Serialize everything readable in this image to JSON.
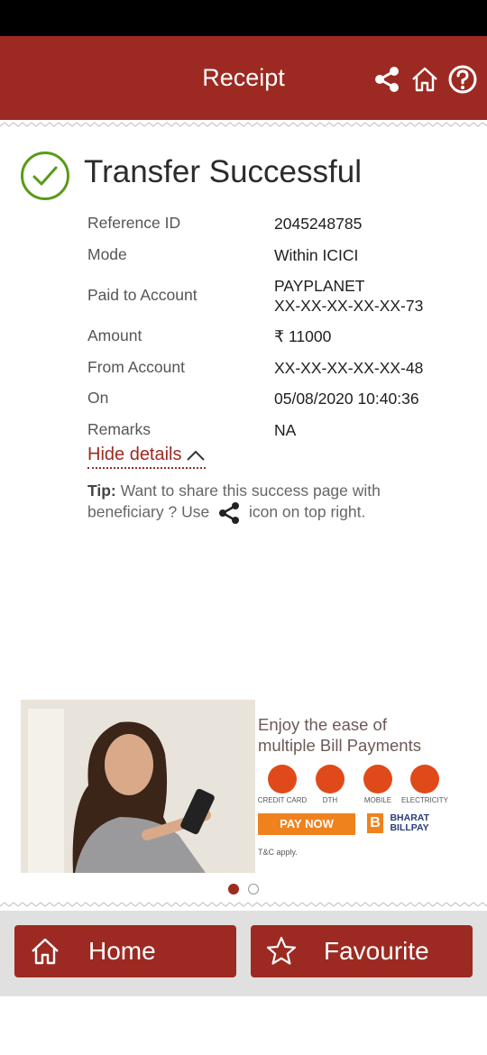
{
  "header": {
    "title": "Receipt",
    "share_icon": "share-icon",
    "home_icon": "home-icon",
    "help_icon": "help-icon"
  },
  "status": {
    "title": "Transfer Successful",
    "icon": "check-circle-icon",
    "color": "#5a9a1a"
  },
  "details": [
    {
      "label": "Reference ID",
      "value": "2045248785"
    },
    {
      "label": "Mode",
      "value": "Within ICICI"
    },
    {
      "label": "Paid to Account",
      "value": "PAYPLANET",
      "value2": "XX-XX-XX-XX-XX-73"
    },
    {
      "label": "Amount",
      "value": "₹ 11000"
    },
    {
      "label": "From Account",
      "value": "XX-XX-XX-XX-XX-48"
    },
    {
      "label": "On",
      "value": "05/08/2020 10:40:36"
    },
    {
      "label": "Remarks",
      "value": "NA"
    }
  ],
  "hide_details": "Hide details",
  "tip": {
    "bold": "Tip:",
    "before": "Want to share this success page with beneficiary ? Use",
    "after": "icon on top right."
  },
  "banner": {
    "line1": "Enjoy the ease of",
    "line2": "multiple Bill Payments",
    "categories": [
      "CREDIT CARD",
      "DTH",
      "MOBILE",
      "ELECTRICITY"
    ],
    "cta": "PAY NOW",
    "logo_mark": "B",
    "brand1": "BHARAT",
    "brand2": "BILLPAY",
    "terms": "T&C apply."
  },
  "carousel": {
    "count": 2,
    "active": 1
  },
  "footer": {
    "home_label": "Home",
    "favourite_label": "Favourite"
  },
  "colors": {
    "brand": "#9c2a22",
    "success": "#5a9a1a",
    "footer_bg": "#e0e0e0"
  }
}
